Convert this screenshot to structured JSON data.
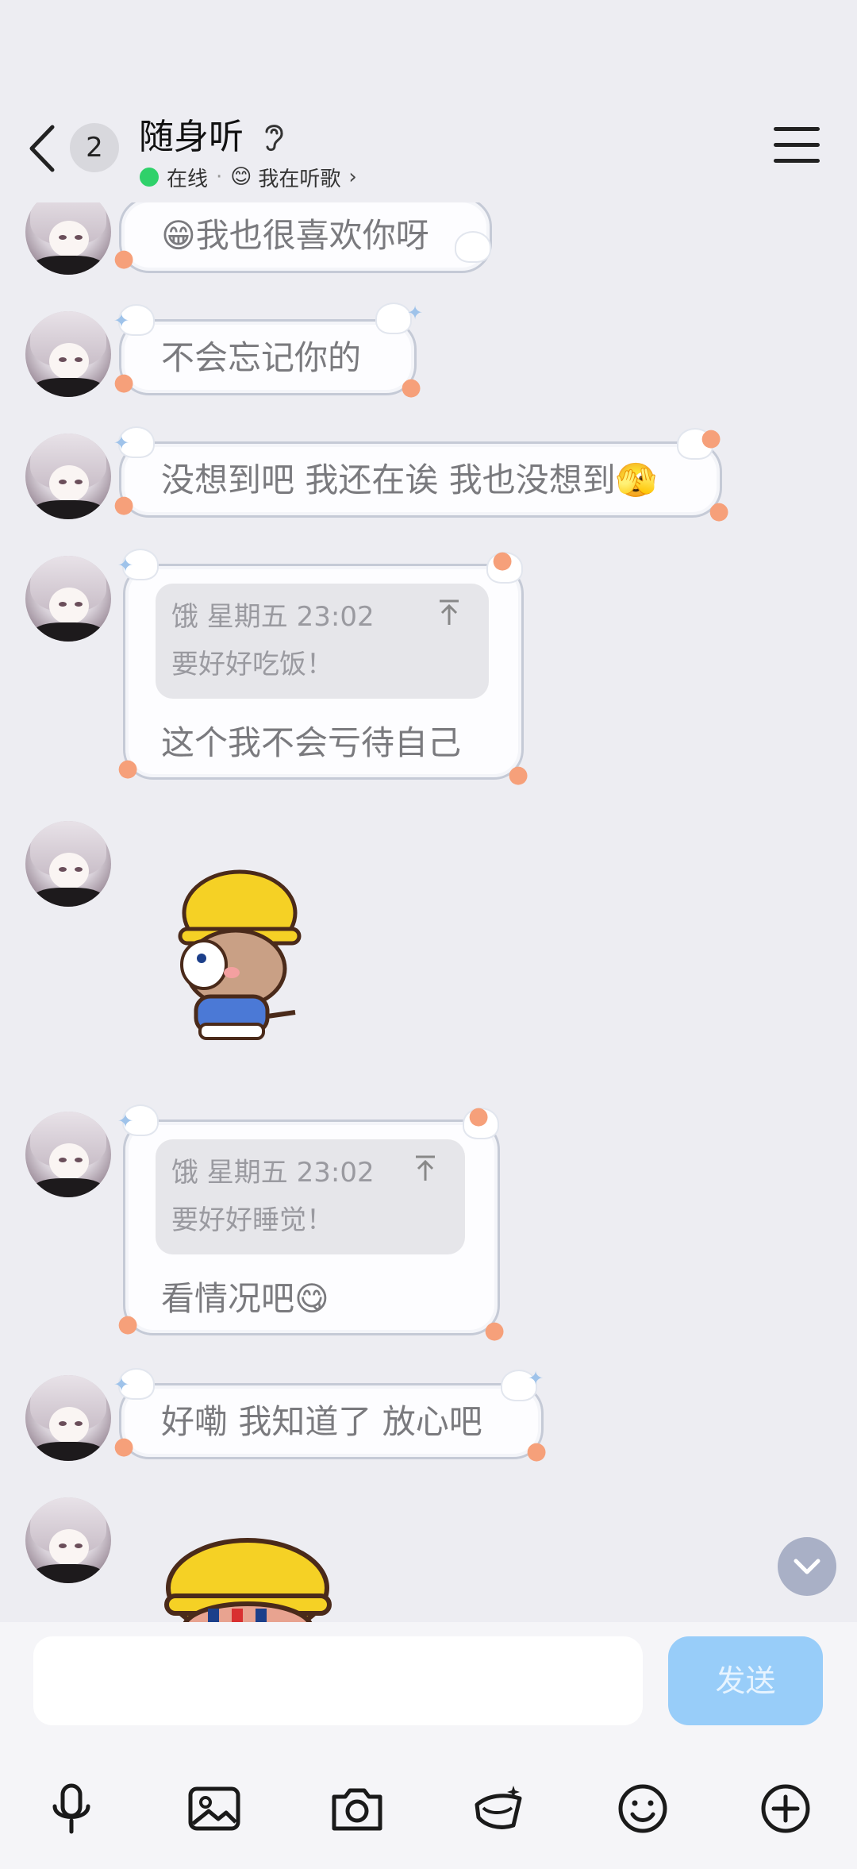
{
  "header": {
    "unread_count": "2",
    "title": "随身听",
    "status_online": "在线",
    "status_separator": "·",
    "status_mood_emoji": "😊",
    "status_activity": "我在听歌",
    "status_chevron": "›"
  },
  "messages": [
    {
      "type": "text",
      "text": "😁我也很喜欢你呀"
    },
    {
      "type": "text",
      "text": "不会忘记你的"
    },
    {
      "type": "text",
      "text": "没想到吧 我还在诶 我也没想到🫣"
    },
    {
      "type": "reply",
      "quote_meta": "饿 星期五 23:02",
      "quote_text": "要好好吃饭！",
      "text": "这个我不会亏待自己"
    },
    {
      "type": "sticker",
      "sticker_name": "yellow-hat-bear-sticker"
    },
    {
      "type": "reply",
      "quote_meta": "饿 星期五 23:02",
      "quote_text": "要好好睡觉！",
      "text": "看情况吧😋"
    },
    {
      "type": "text",
      "text": "好嘞 我知道了 放心吧"
    },
    {
      "type": "sticker",
      "sticker_name": "yellow-hat-bear-sticker-2"
    }
  ],
  "composer": {
    "input_value": "",
    "send_label": "发送"
  },
  "toolbar": {
    "icons": [
      "microphone-icon",
      "image-icon",
      "camera-icon",
      "red-packet-icon",
      "emoji-icon",
      "plus-icon"
    ]
  },
  "colors": {
    "background": "#ededf2",
    "bubble_border": "#c5cad6",
    "send_button": "#98cdf9",
    "online_dot": "#2fd16a"
  }
}
